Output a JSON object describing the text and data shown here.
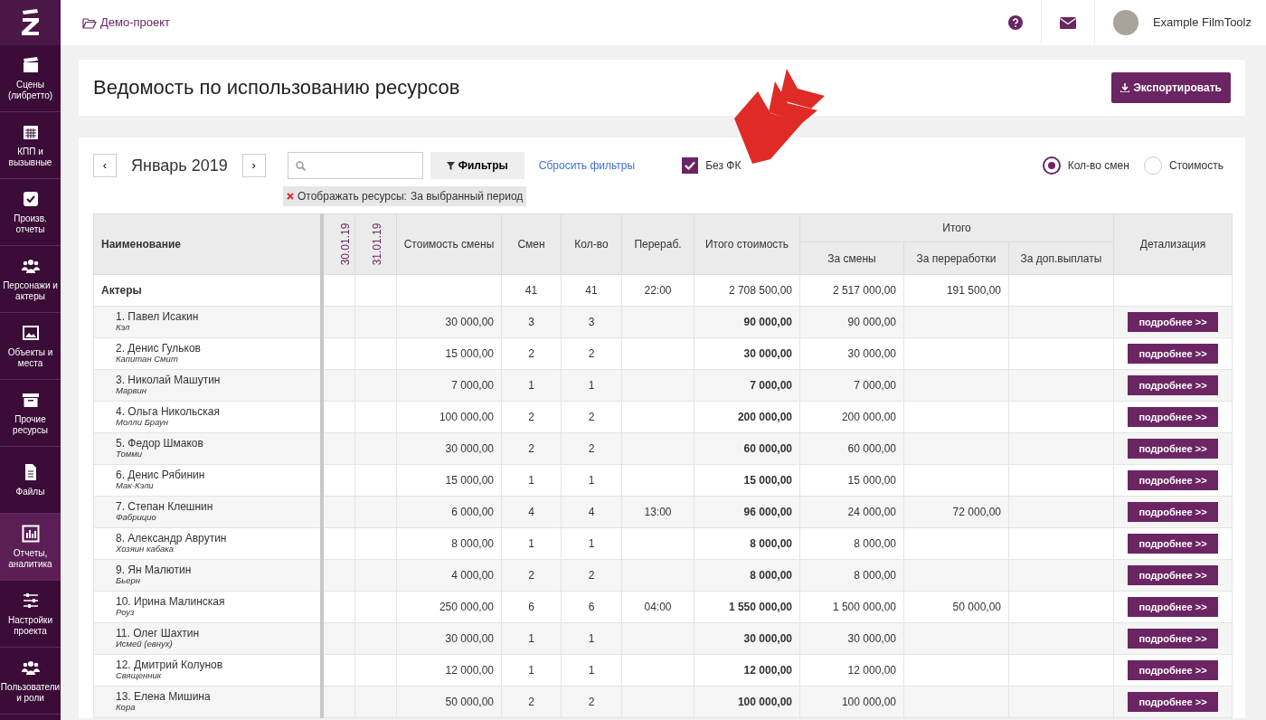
{
  "sidebar": {
    "items": [
      {
        "label": "Сцены (либретто)",
        "selected": false
      },
      {
        "label": "КПП и вызывные",
        "selected": false
      },
      {
        "label": "Произв. отчеты",
        "selected": false
      },
      {
        "label": "Персонажи и актеры",
        "selected": false
      },
      {
        "label": "Объекты и места",
        "selected": false
      },
      {
        "label": "Прочие ресурсы",
        "selected": false
      },
      {
        "label": "Файлы",
        "selected": false
      },
      {
        "label": "Отчеты, аналитика",
        "selected": true
      },
      {
        "label": "Настройки проекта",
        "selected": false
      },
      {
        "label": "Пользователи и роли",
        "selected": false
      }
    ]
  },
  "header": {
    "project": "Демо-проект",
    "user": "Example FilmToolz"
  },
  "page": {
    "title": "Ведомость по использованию ресурсов",
    "export_button": "Экспортировать"
  },
  "filters": {
    "prev": "‹",
    "month": "Январь 2019",
    "next": "›",
    "filters_button": "Фильтры",
    "reset_link": "Сбросить фильтры",
    "no_fk": {
      "label": "Без ФК",
      "checked": true
    },
    "modes": [
      {
        "label": "Кол-во смен",
        "selected": true
      },
      {
        "label": "Стоимость",
        "selected": false
      }
    ],
    "tag": {
      "label": "Отображать ресурсы:",
      "value": "За выбранный период"
    }
  },
  "table": {
    "columns": {
      "name": "Наименование",
      "dates": [
        "30.01.19",
        "31.01.19"
      ],
      "cost": "Стоимость смены",
      "shifts": "Смен",
      "qty": "Кол-во",
      "overtime": "Перераб.",
      "total": "Итого стоимость",
      "group": "Итого",
      "sub": [
        "За смены",
        "За переработки",
        "За доп.выплаты"
      ],
      "detail": "Детализация"
    },
    "group": {
      "name": "Актеры",
      "shifts": "41",
      "qty": "41",
      "overtime": "22:00",
      "total": "2 708 500,00",
      "for_shifts": "2 517 000,00",
      "for_overtime": "191 500,00"
    },
    "rows": [
      {
        "name": "1. Павел Исакин",
        "role": "Кэл",
        "cost": "30 000,00",
        "shifts": "3",
        "qty": "3",
        "total": "90 000,00",
        "for_shifts": "90 000,00",
        "button": "подробнее >>"
      },
      {
        "name": "2. Денис Гульков",
        "role": "Капитан Смит",
        "cost": "15 000,00",
        "shifts": "2",
        "qty": "2",
        "total": "30 000,00",
        "for_shifts": "30 000,00",
        "button": "подробнее >>"
      },
      {
        "name": "3. Николай Машутин",
        "role": "Марвин",
        "cost": "7 000,00",
        "shifts": "1",
        "qty": "1",
        "total": "7 000,00",
        "for_shifts": "7 000,00",
        "button": "подробнее >>"
      },
      {
        "name": "4. Ольга Никольская",
        "role": "Молли Браун",
        "cost": "100 000,00",
        "shifts": "2",
        "qty": "2",
        "total": "200 000,00",
        "for_shifts": "200 000,00",
        "button": "подробнее >>"
      },
      {
        "name": "5. Федор Шмаков",
        "role": "Томми",
        "cost": "30 000,00",
        "shifts": "2",
        "qty": "2",
        "total": "60 000,00",
        "for_shifts": "60 000,00",
        "button": "подробнее >>"
      },
      {
        "name": "6. Денис Рябинин",
        "role": "Мак-Кэли",
        "cost": "15 000,00",
        "shifts": "1",
        "qty": "1",
        "total": "15 000,00",
        "for_shifts": "15 000,00",
        "button": "подробнее >>"
      },
      {
        "name": "7. Степан Клешнин",
        "role": "Фабрицио",
        "cost": "6 000,00",
        "shifts": "4",
        "qty": "4",
        "overtime": "13:00",
        "total": "96 000,00",
        "for_shifts": "24 000,00",
        "for_overtime": "72 000,00",
        "button": "подробнее >>"
      },
      {
        "name": "8. Александр Аврутин",
        "role": "Хозяин кабака",
        "cost": "8 000,00",
        "shifts": "1",
        "qty": "1",
        "total": "8 000,00",
        "for_shifts": "8 000,00",
        "button": "подробнее >>"
      },
      {
        "name": "9. Ян Малютин",
        "role": "Бьерн",
        "cost": "4 000,00",
        "shifts": "2",
        "qty": "2",
        "total": "8 000,00",
        "for_shifts": "8 000,00",
        "button": "подробнее >>"
      },
      {
        "name": "10. Ирина Малинская",
        "role": "Роуз",
        "cost": "250 000,00",
        "shifts": "6",
        "qty": "6",
        "overtime": "04:00",
        "total": "1 550 000,00",
        "for_shifts": "1 500 000,00",
        "for_overtime": "50 000,00",
        "button": "подробнее >>"
      },
      {
        "name": "11. Олег Шахтин",
        "role": "Исмей (евнух)",
        "cost": "30 000,00",
        "shifts": "1",
        "qty": "1",
        "total": "30 000,00",
        "for_shifts": "30 000,00",
        "button": "подробнее >>"
      },
      {
        "name": "12. Дмитрий Колунов",
        "role": "Священник",
        "cost": "12 000,00",
        "shifts": "1",
        "qty": "1",
        "total": "12 000,00",
        "for_shifts": "12 000,00",
        "button": "подробнее >>"
      },
      {
        "name": "13. Елена Мишина",
        "role": "Кора",
        "cost": "50 000,00",
        "shifts": "2",
        "qty": "2",
        "total": "100 000,00",
        "for_shifts": "100 000,00",
        "button": "подробнее >>"
      }
    ]
  }
}
